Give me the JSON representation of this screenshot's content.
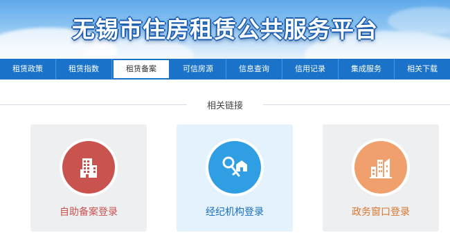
{
  "header": {
    "title": "无锡市住房租赁公共服务平台"
  },
  "nav": {
    "items": [
      {
        "label": "租赁政策"
      },
      {
        "label": "租赁指数"
      },
      {
        "label": "租赁备案"
      },
      {
        "label": "可信房源"
      },
      {
        "label": "信息查询"
      },
      {
        "label": "信用记录"
      },
      {
        "label": "集成服务"
      },
      {
        "label": "相关下载"
      }
    ],
    "active_label": "租赁备案"
  },
  "section": {
    "title": "相关链接"
  },
  "cards": [
    {
      "label": "自助备案登录",
      "icon": "building-icon",
      "color": "#c9534f",
      "text_color": "#c9534f"
    },
    {
      "label": "经纪机构登录",
      "icon": "keys-icon",
      "color": "#2f9ee3",
      "text_color": "#1b6fbf"
    },
    {
      "label": "政务窗口登录",
      "icon": "city-buildings-icon",
      "color": "#f0a06d",
      "text_color": "#d9762e"
    }
  ],
  "colors": {
    "nav_bg": "#1a73c9",
    "card_bg": "#eeeff1",
    "card_active_bg": "#e4f2fd"
  }
}
